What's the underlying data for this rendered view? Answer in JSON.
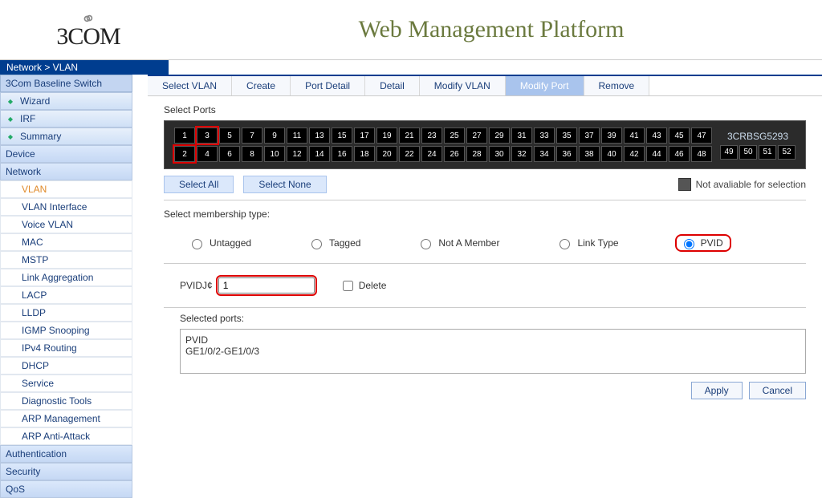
{
  "logo_text": "3COM",
  "page_title": "Web Management Platform",
  "breadcrumb": "Network > VLAN",
  "sidebar": {
    "root": "3Com Baseline Switch",
    "groups_top": [
      "Wizard",
      "IRF",
      "Summary"
    ],
    "cat_device": "Device",
    "cat_network": "Network",
    "network_items": [
      "VLAN",
      "VLAN Interface",
      "Voice VLAN",
      "MAC",
      "MSTP",
      "Link Aggregation",
      "LACP",
      "LLDP",
      "IGMP Snooping",
      "IPv4 Routing",
      "DHCP",
      "Service",
      "Diagnostic Tools",
      "ARP Management",
      "ARP Anti-Attack"
    ],
    "cat_auth": "Authentication",
    "cat_sec": "Security",
    "cat_qos": "QoS"
  },
  "tabs": [
    "Select VLAN",
    "Create",
    "Port Detail",
    "Detail",
    "Modify VLAN",
    "Modify Port",
    "Remove"
  ],
  "active_tab": 5,
  "labels": {
    "select_ports": "Select Ports",
    "select_all": "Select All",
    "select_none": "Select None",
    "legend": "Not avaliable for selection",
    "membership": "Select membership type:",
    "pvid_label": "PVIDJ¢",
    "delete": "Delete",
    "selected_ports": "Selected ports:",
    "result_head": "PVID",
    "result_val": "GE1/0/2-GE1/0/3",
    "apply": "Apply",
    "cancel": "Cancel"
  },
  "radios": [
    "Untagged",
    "Tagged",
    "Not A Member",
    "Link Type",
    "PVID"
  ],
  "pvid_value": "1",
  "model": "3CRBSG5293",
  "mini_ports": [
    "49",
    "50",
    "51",
    "52"
  ],
  "ports_top": [
    "1",
    "3",
    "5",
    "7",
    "9",
    "11",
    "13",
    "15",
    "17",
    "19",
    "21",
    "23",
    "25",
    "27",
    "29",
    "31",
    "33",
    "35",
    "37",
    "39",
    "41",
    "43",
    "45",
    "47"
  ],
  "ports_bot": [
    "2",
    "4",
    "6",
    "8",
    "10",
    "12",
    "14",
    "16",
    "18",
    "20",
    "22",
    "24",
    "26",
    "28",
    "30",
    "32",
    "34",
    "36",
    "38",
    "40",
    "42",
    "44",
    "46",
    "48"
  ],
  "selected_ports": [
    "2",
    "3"
  ]
}
